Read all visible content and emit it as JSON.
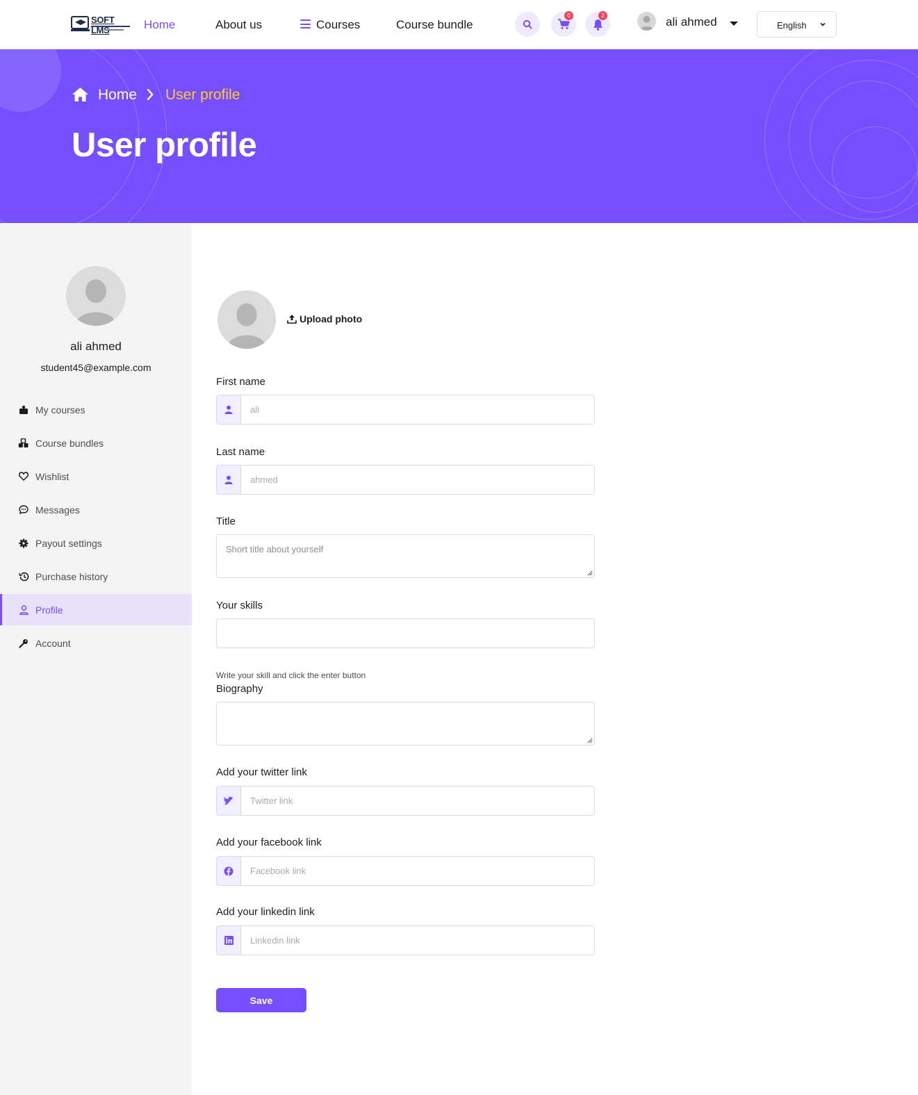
{
  "header": {
    "logo_text": "SOFT LMS",
    "nav": {
      "home": "Home",
      "about": "About us",
      "courses": "Courses",
      "bundle": "Course bundle"
    },
    "cart_count": "0",
    "notification_count": "2",
    "user_name": "ali ahmed",
    "language": "English"
  },
  "hero": {
    "breadcrumb_home": "Home",
    "breadcrumb_current": "User profile",
    "title": "User profile"
  },
  "sidebar": {
    "name": "ali ahmed",
    "email": "student45@example.com",
    "items": [
      {
        "label": "My courses",
        "icon": "courses-icon"
      },
      {
        "label": "Course bundles",
        "icon": "bundles-icon"
      },
      {
        "label": "Wishlist",
        "icon": "heart-icon"
      },
      {
        "label": "Messages",
        "icon": "chat-icon"
      },
      {
        "label": "Payout settings",
        "icon": "gear-icon"
      },
      {
        "label": "Purchase history",
        "icon": "history-icon"
      },
      {
        "label": "Profile",
        "icon": "user-icon",
        "active": true
      },
      {
        "label": "Account",
        "icon": "key-icon"
      }
    ]
  },
  "form": {
    "upload_label": "Upload photo",
    "first_name": {
      "label": "First name",
      "value": "ali"
    },
    "last_name": {
      "label": "Last name",
      "value": "ahmed"
    },
    "title": {
      "label": "Title",
      "placeholder": "Short title about yourself"
    },
    "skills": {
      "label": "Your skills",
      "hint": "Write your skill and click the enter button"
    },
    "biography": {
      "label": "Biography"
    },
    "twitter": {
      "label": "Add your twitter link",
      "placeholder": "Twitter link"
    },
    "facebook": {
      "label": "Add your facebook link",
      "placeholder": "Facebook link"
    },
    "linkedin": {
      "label": "Add your linkedin link",
      "placeholder": "Linkedin link"
    },
    "save_label": "Save"
  },
  "colors": {
    "accent": "#754ffe",
    "breadcrumb_active": "#ffc933",
    "badge": "#f0445f"
  }
}
